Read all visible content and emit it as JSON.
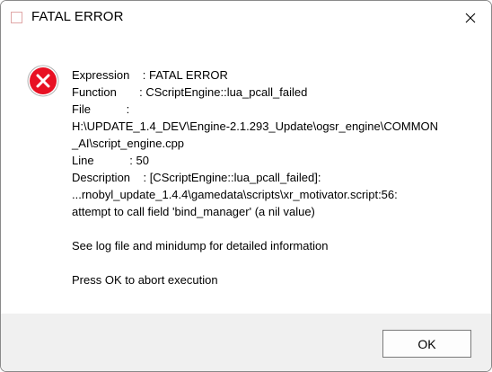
{
  "window": {
    "title": "FATAL ERROR",
    "close_icon": "close-icon"
  },
  "dialog": {
    "icon": "error-icon",
    "icon_color": "#e81123",
    "lines": [
      "Expression    : FATAL ERROR",
      "Function       : CScriptEngine::lua_pcall_failed",
      "File           :",
      "H:\\UPDATE_1.4_DEV\\Engine-2.1.293_Update\\ogsr_engine\\COMMON",
      "_AI\\script_engine.cpp",
      "Line           : 50",
      "Description    : [CScriptEngine::lua_pcall_failed]:",
      "...rnobyl_update_1.4.4\\gamedata\\scripts\\xr_motivator.script:56:",
      "attempt to call field 'bind_manager' (a nil value)"
    ],
    "info_text": "See log file and minidump for detailed information",
    "prompt_text": "Press OK to abort execution"
  },
  "footer": {
    "ok_label": "OK"
  }
}
